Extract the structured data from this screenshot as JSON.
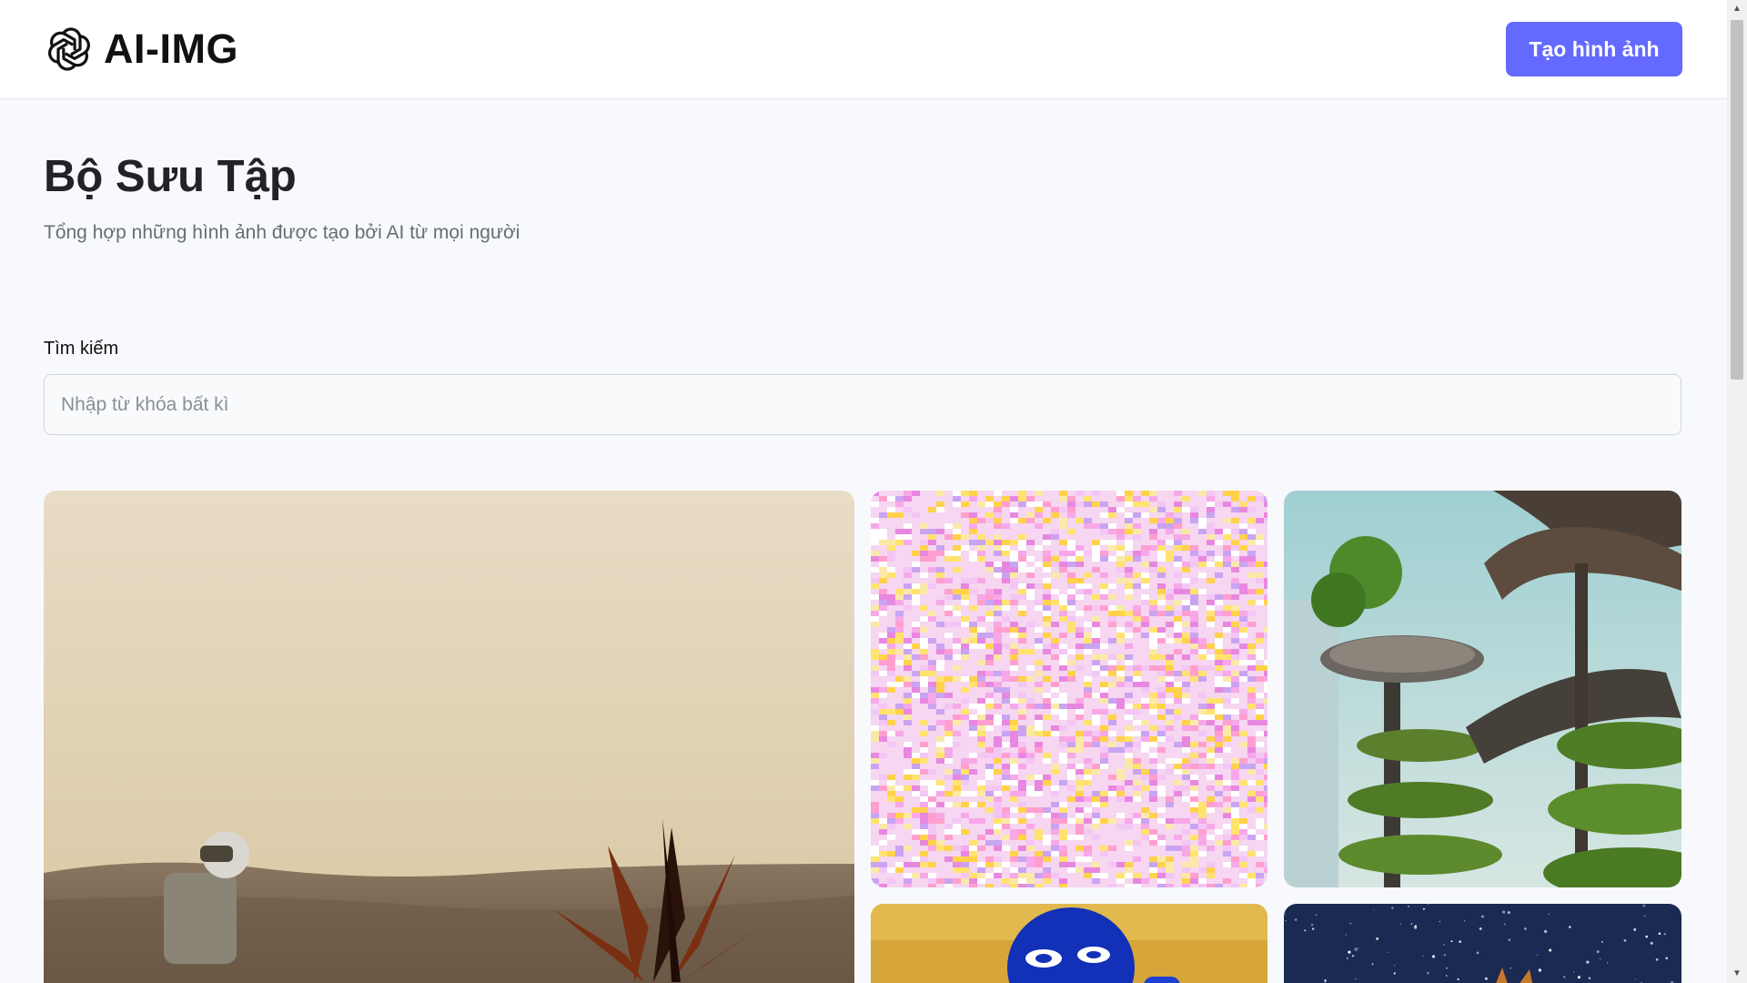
{
  "header": {
    "logo_icon": "openai-knot-icon",
    "logo_text": "AI-IMG",
    "create_button_label": "Tạo hình ảnh",
    "accent_color": "#6469ff"
  },
  "page": {
    "title": "Bộ Sưu Tập",
    "subtitle": "Tổng hợp những hình ảnh được tạo bởi AI từ mọi người"
  },
  "search": {
    "label": "Tìm kiếm",
    "placeholder": "Nhập từ khóa bất kì",
    "value": ""
  },
  "gallery": {
    "images": [
      "astronaut-desert-plant-image",
      "colorful-pixel-noise-image",
      "futuristic-green-towers-image",
      "blue-mask-yellow-background-image",
      "night-sky-stars-image"
    ]
  },
  "scrollbar": {
    "up_icon": "▲",
    "down_icon": "▼"
  }
}
